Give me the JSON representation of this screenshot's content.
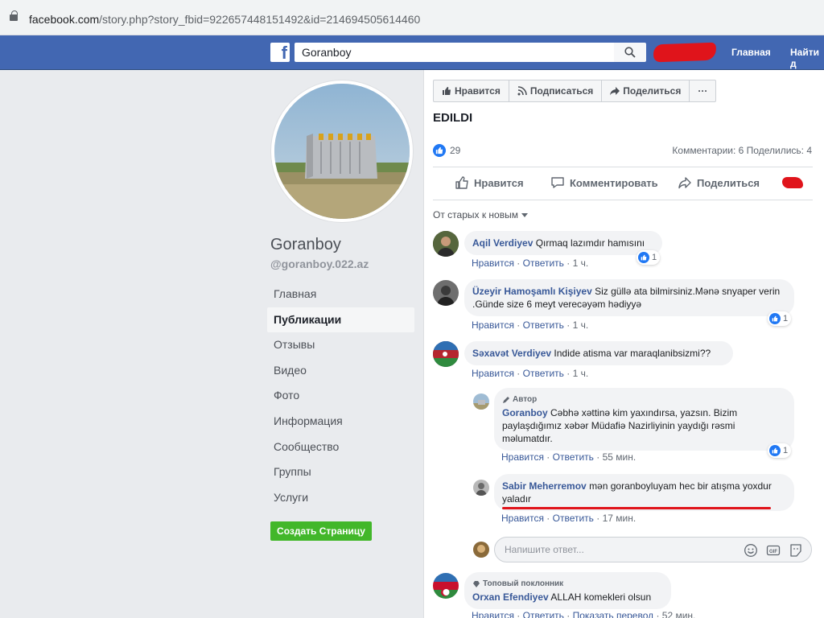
{
  "browser": {
    "url_host": "facebook.com",
    "url_path": "/story.php?story_fbid=922657448151492&id=214694505614460"
  },
  "header": {
    "logo": "f",
    "search_value": "Goranboy",
    "nav": [
      "Главная",
      "Найти д"
    ]
  },
  "page": {
    "name": "Goranboy",
    "handle": "@goranboy.022.az",
    "nav": [
      "Главная",
      "Публикации",
      "Отзывы",
      "Видео",
      "Фото",
      "Информация",
      "Сообщество",
      "Группы",
      "Услуги"
    ],
    "active_nav": "Публикации",
    "create_button": "Создать Страницу"
  },
  "page_actions": {
    "like": "Нравится",
    "subscribe": "Подписаться",
    "share": "Поделиться",
    "more": "···"
  },
  "post": {
    "title_fragment": "EDILDI",
    "likes": "29",
    "comments_info": "Комментарии: 6  Поделились: 4",
    "actions": {
      "like": "Нравится",
      "comment": "Комментировать",
      "share": "Поделиться"
    },
    "sort_label": "От старых к новым"
  },
  "comments": [
    {
      "author": "Aqil Verdiyev",
      "text": "Qırmaq lazımdır hamısını",
      "like_label": "Нравится",
      "reply_label": "Ответить",
      "time": "1 ч.",
      "reactions": "1"
    },
    {
      "author": "Üzeyir Hamoşamlı Kişiyev",
      "text": "Siz güllə ata bilmirsiniz.Mənə snyaper verin .Günde size 6 meyt verecəyəm hədiyyə",
      "like_label": "Нравится",
      "reply_label": "Ответить",
      "time": "1 ч.",
      "reactions": "1"
    },
    {
      "author": "Səxavət Verdiyev",
      "text": "Indide atisma var maraqlanibsizmi??",
      "like_label": "Нравится",
      "reply_label": "Ответить",
      "time": "1 ч."
    },
    {
      "badge": "Автор",
      "author": "Goranboy",
      "text": "Cəbhə xəttinə kim yaxındırsa, yazsın. Bizim paylaşdığımız xəbər Müdafiə Nazirliyinin yaydığı rəsmi məlumatdır.",
      "like_label": "Нравится",
      "reply_label": "Ответить",
      "time": "55 мин.",
      "reactions": "1"
    },
    {
      "author": "Sabir Meherremov",
      "text": "mən goranboyluyam hec bir atışma yoxdur yaladır",
      "like_label": "Нравится",
      "reply_label": "Ответить",
      "time": "17 мин."
    },
    {
      "badge": "Топовый поклонник",
      "author": "Orxan Efendiyev",
      "text": "ALLAH komekleri olsun",
      "like_label": "Нравится",
      "reply_label": "Ответить",
      "translate_label": "Показать перевод",
      "time": "52 мин."
    }
  ],
  "reply_box": {
    "placeholder": "Напишите ответ..."
  },
  "colors": {
    "facebook_blue": "#4267b2",
    "link_blue": "#385898",
    "like_blue": "#2078f4",
    "green_button": "#42b72a",
    "red_marking": "#e0141b"
  }
}
